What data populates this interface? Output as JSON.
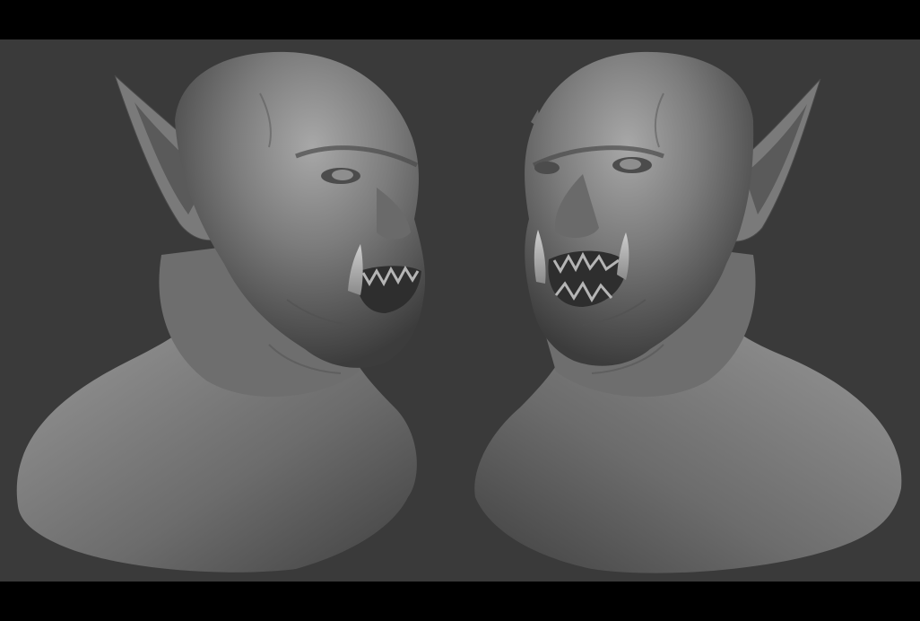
{
  "scene": {
    "background_color": "#3a3a3a",
    "letterbox_color": "#000000",
    "subject": "sculpt-render",
    "views": [
      {
        "id": "left-bust",
        "facing": "right"
      },
      {
        "id": "right-bust",
        "facing": "left"
      }
    ],
    "material_color": "#8a8a8a"
  }
}
